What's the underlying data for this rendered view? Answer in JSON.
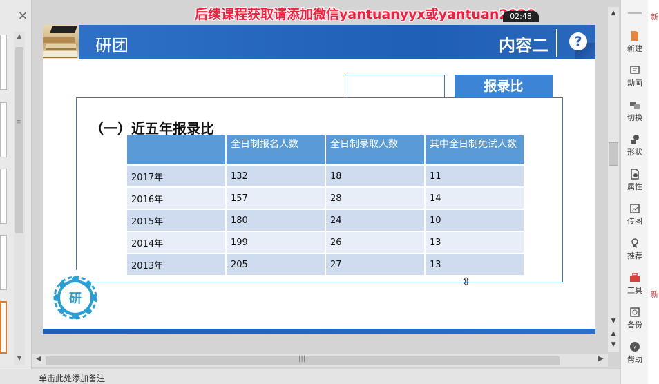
{
  "watermark": "后续课程获取请添加微信yantuanyyx或yantuan2020",
  "timestamp": "02:48",
  "slide": {
    "logo_text": "研团",
    "section": "内容二",
    "help": "?",
    "ratio_label": "报录比",
    "section_title": "（一）近五年报录比",
    "logo_char": "研",
    "table": {
      "headers": [
        "",
        "全日制报名人数",
        "全日制录取人数",
        "其中全日制免试人数"
      ],
      "rows": [
        [
          "2017年",
          "132",
          "18",
          "11"
        ],
        [
          "2016年",
          "157",
          "28",
          "14"
        ],
        [
          "2015年",
          "180",
          "24",
          "10"
        ],
        [
          "2014年",
          "199",
          "26",
          "13"
        ],
        [
          "2013年",
          "205",
          "27",
          "13"
        ]
      ]
    }
  },
  "notes_placeholder": "单击此处添加备注",
  "right_toolbar": [
    {
      "label": "新建",
      "icon": "new-file-icon"
    },
    {
      "label": "动画",
      "icon": "animation-icon"
    },
    {
      "label": "切换",
      "icon": "transition-icon"
    },
    {
      "label": "形状",
      "icon": "shape-icon"
    },
    {
      "label": "属性",
      "icon": "properties-icon"
    },
    {
      "label": "传图",
      "icon": "upload-image-icon"
    },
    {
      "label": "推荐",
      "icon": "recommend-icon"
    },
    {
      "label": "工具",
      "icon": "toolbox-icon"
    },
    {
      "label": "备份",
      "icon": "backup-icon"
    },
    {
      "label": "帮助",
      "icon": "help-icon"
    }
  ],
  "far_right": [
    "新",
    "新"
  ],
  "colors": {
    "header_blue": "#1f5fb5",
    "table_header": "#5b9bd5",
    "row_odd": "#cfdcef",
    "row_even": "#e8eef8",
    "watermark_red": "#ff1a3a"
  }
}
